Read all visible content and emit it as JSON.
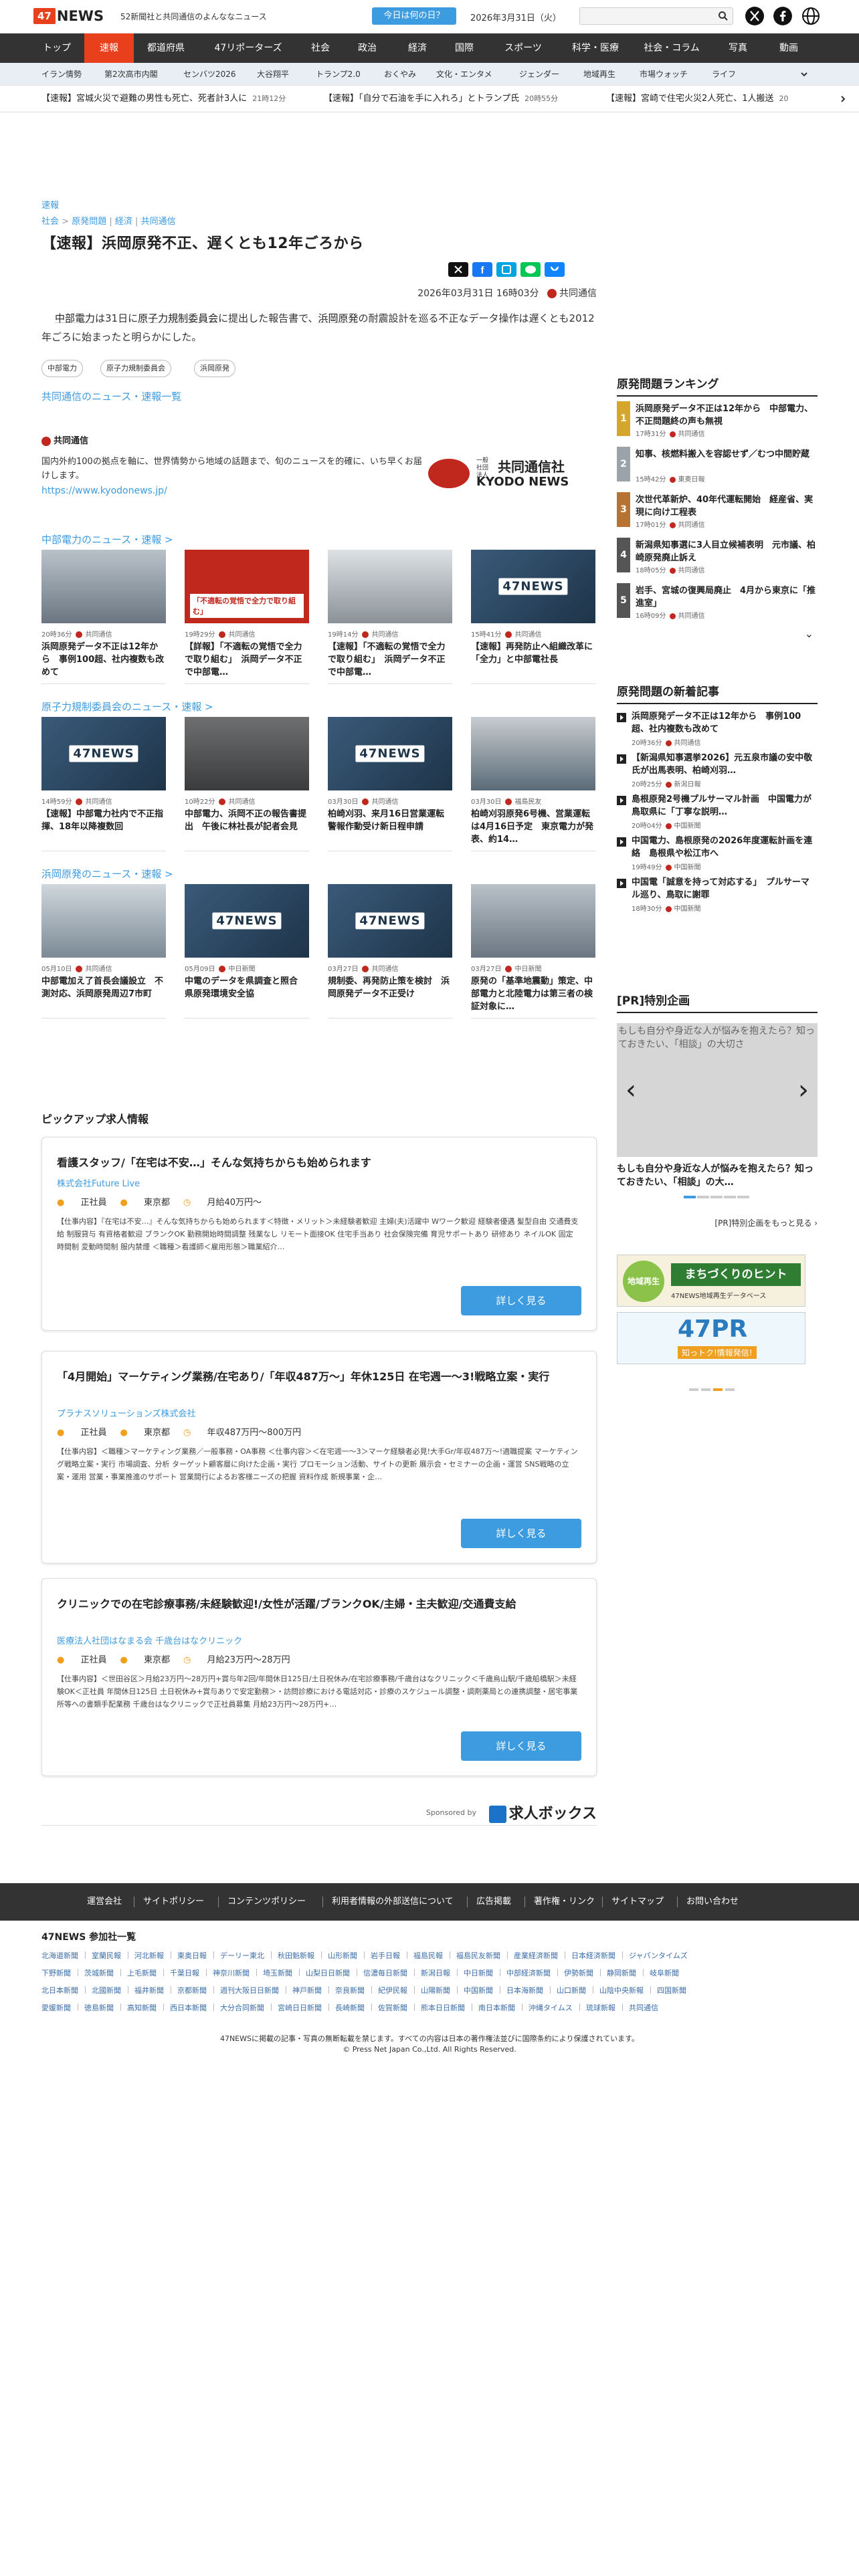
{
  "header": {
    "logo_box": "47",
    "logo_text": "NEWS",
    "tagline": "52新聞社と共同通信のよんななニュース",
    "day_button": "今日は何の日？",
    "date": "2026年3月31日（火）",
    "search_placeholder": ""
  },
  "nav": [
    "トップ",
    "速報",
    "都道府県",
    "47リポーターズ",
    "社会",
    "政治",
    "経済",
    "国際",
    "スポーツ",
    "科学・医療",
    "社会・コラム",
    "写真",
    "動画"
  ],
  "subnav": [
    "イラン情勢",
    "第2次高市内閣",
    "センバツ2026",
    "大谷翔平",
    "トランプ2.0",
    "おくやみ",
    "文化・エンタメ",
    "ジェンダー",
    "地域再生",
    "市場ウォッチ",
    "ライフ"
  ],
  "ticker": [
    {
      "text": "【速報】宮城火災で避難の男性も死亡、死者計3人に",
      "time": "21時12分"
    },
    {
      "text": "【速報】「自分で石油を手に入れろ」とトランプ氏",
      "time": "20時55分"
    },
    {
      "text": "【速報】宮崎で住宅火災2人死亡、1人搬送",
      "time": "20"
    }
  ],
  "article": {
    "crumb_top": "速報",
    "crumbs": [
      "社会",
      "原発問題",
      "経済",
      "共同通信"
    ],
    "crumb_sep1": ">",
    "crumb_sep2": "|",
    "title": "【速報】浜岡原発不正、遅くとも12年ごろから",
    "datetime": "2026年03月31日 16時03分",
    "source": "共同通信",
    "lead_1": "中部電力",
    "lead_2": "は31日に",
    "lead_3": "原子力規制委員会",
    "lead_4": "に提出した報告書で、",
    "lead_5": "浜岡原発",
    "lead_6": "の耐震設計を巡る不正なデータ操作は遅くとも2012年ごろに始まったと明らかにした。",
    "tags": [
      "中部電力",
      "原子力規制委員会",
      "浜岡原発"
    ],
    "more_link": "共同通信のニュース・速報一覧",
    "kyodo_label": "共同通信",
    "kyodo_desc": "国内外約100の拠点を軸に、世界情勢から地域の話題まで、旬のニュースを的確に、いち早くお届けします。",
    "kyodo_url": "https://www.kyodonews.jp/",
    "kyodo_logo_small": "一般社団法人",
    "kyodo_logo_big": "共同通信社",
    "kyodo_logo_en": "KYODO NEWS"
  },
  "sections": [
    {
      "title": "中部電力のニュース・速報",
      "cards": [
        {
          "time": "20時36分",
          "src": "共同通信",
          "title": "浜岡原発データ不正は12年から　事例100超、社内複数も改めて",
          "img": "photo1"
        },
        {
          "time": "19時29分",
          "src": "共同通信",
          "title": "【詳報】「不適転の覚悟で全力で取り組む」　浜岡データ不正で中部電…",
          "img": "photo2",
          "overlay": "「不適転の覚悟で全力で取り組む」"
        },
        {
          "time": "19時14分",
          "src": "共同通信",
          "title": "【速報】「不適転の覚悟で全力で取り組む」　浜岡データ不正で中部電…",
          "img": "photo3"
        },
        {
          "time": "15時41分",
          "src": "共同通信",
          "title": "【速報】再発防止へ組織改革に「全力」と中部電社長",
          "img": "news"
        }
      ]
    },
    {
      "title": "原子力規制委員会のニュース・速報",
      "cards": [
        {
          "time": "14時59分",
          "src": "共同通信",
          "title": "【速報】中部電力社内で不正指揮、18年以降複数回",
          "img": "news"
        },
        {
          "time": "10時22分",
          "src": "共同通信",
          "title": "中部電力、浜岡不正の報告書提出　午後に林社長が記者会見",
          "img": "photo4"
        },
        {
          "time": "03月30日",
          "src": "共同通信",
          "title": "柏崎刈羽、来月16日営業運転　警報作動受け新日程申請",
          "img": "news"
        },
        {
          "time": "03月30日",
          "src": "福島民友",
          "title": "柏崎刈羽原発6号機、営業運転は4月16日予定　東京電力が発表、約14…",
          "img": "photo5"
        }
      ]
    },
    {
      "title": "浜岡原発のニュース・速報",
      "cards": [
        {
          "time": "05月10日",
          "src": "共同通信",
          "title": "中部電加え了首長会議設立　不測対応、浜岡原発周辺7市町",
          "img": "photo6"
        },
        {
          "time": "05月09日",
          "src": "中日新聞",
          "title": "中電のデータを県調査と照合　県原発環境安全協",
          "img": "news"
        },
        {
          "time": "03月27日",
          "src": "共同通信",
          "title": "規制委、再発防止策を検討　浜岡原発データ不正受け",
          "img": "news"
        },
        {
          "time": "03月27日",
          "src": "中日新聞",
          "title": "原発の「基準地震動」策定、中部電力と北陸電力は第三者の検証対象に…",
          "img": "photo1"
        }
      ]
    }
  ],
  "pickup": {
    "heading": "ピックアップ求人情報",
    "jobs": [
      {
        "title": "看護スタッフ/「在宅は不安…」そんな気持ちからも始められます",
        "company": "株式会社Future Live",
        "type": "正社員",
        "place": "東京都",
        "salary": "月給40万円〜",
        "desc": "【仕事内容】『在宅は不安…』そんな気持ちからも始められます＜特徴・メリット＞未経験者歓迎 主婦(夫)活躍中 Wワーク歓迎 経験者優遇 髪型自由 交通費支給 制服貸与 有資格者歓迎 ブランクOK 勤務開始時間調整 残業なし リモート面接OK 住宅手当あり 社会保険完備 育児サポートあり 研修あり ネイルOK 固定時間制 変動時間制 服内禁煙 ＜職種＞看護師＜雇用形態＞職業紹介…",
        "button": "詳しく見る"
      },
      {
        "title": "「4月開始」マーケティング業務/在宅あり/「年収487万〜」年休125日 在宅週一〜3!戦略立案・実行",
        "company": "プラナスソリューションズ株式会社",
        "type": "正社員",
        "place": "東京都",
        "salary": "年収487万円〜800万円",
        "desc": "【仕事内容】＜職種＞マーケティング業務／一般事務・OA事務 ＜仕事内容＞＜在宅週一〜3＞マーケ経験者必見!大手Gr/年収487万〜!適職提案 マーケティング戦略立案・実行 市場調査、分析 ターゲット顧客層に向けた企画・実行 プロモーション活動、サイトの更新 展示会・セミナーの企画・運営 SNS戦略の立案・運用 営業・事業推進のサポート 営業間行によるお客様ニーズの把握 資料作成 新規事業・企…",
        "button": "詳しく見る"
      },
      {
        "title": "クリニックでの在宅診療事務/未経験歓迎!/女性が活躍/ブランクOK/主婦・主夫歓迎/交通費支給",
        "company": "医療法人社団はなまる会 千歳台はなクリニック",
        "type": "正社員",
        "place": "東京都",
        "salary": "月給23万円〜28万円",
        "desc": "【仕事内容】＜世田谷区＞月給23万円〜28万円+賞与年2回/年間休日125日/土日祝休み/在宅診療事務/千歳台はなクリニック＜千歳烏山駅/千歳船橋駅＞未経験OK＜正社員 年間休日125日 土日祝休み+賞与ありで安定勤務＞・訪問診療における電話対応・診療のスケジュール調整・調剤薬局との連携調整・居宅事業所等への書類手配業務 千歳台はなクリニックで正社員募集 月給23万円〜28万円+…",
        "button": "詳しく見る"
      }
    ],
    "sponsored": "Sponsored by",
    "sponsor_name": "求人ボックス"
  },
  "sidebar": {
    "ranking_title": "原発問題ランキング",
    "ranking": [
      {
        "n": "1",
        "title": "浜岡原発データ不正は12年から　中部電力、不正問題終の声も無視",
        "meta": "17時31分",
        "src": "共同通信",
        "color": "#d4a72c"
      },
      {
        "n": "2",
        "title": "知事、核燃料搬入を容認せず／むつ中間貯蔵",
        "meta": "15時42分",
        "src": "東奥日報",
        "color": "#9aa3a9"
      },
      {
        "n": "3",
        "title": "次世代革新炉、40年代運転開始　経産省、実現に向け工程表",
        "meta": "17時01分",
        "src": "共同通信",
        "color": "#b87333"
      },
      {
        "n": "4",
        "title": "新潟県知事選に3人目立候補表明　元市議、柏崎原発廃止訴え",
        "meta": "18時05分",
        "src": "共同通信",
        "color": "#555"
      },
      {
        "n": "5",
        "title": "岩手、宮城の復興局廃止　4月から東京に「推進室」",
        "meta": "16時09分",
        "src": "共同通信",
        "color": "#555"
      }
    ],
    "new_title": "原発問題の新着記事",
    "new_items": [
      {
        "title": "浜岡原発データ不正は12年から　事例100超、社内複数も改めて",
        "meta": "20時36分",
        "src": "共同通信"
      },
      {
        "title": "【新潟県知事選挙2026】元五泉市議の安中敬氏が出馬表明、柏崎刈羽…",
        "meta": "20時25分",
        "src": "新潟日報"
      },
      {
        "title": "島根原発2号機プルサーマル計画　中国電力が鳥取県に「丁寧な説明…",
        "meta": "20時04分",
        "src": "中国新聞"
      },
      {
        "title": "中国電力、島根原発の2026年度運転計画を連絡　島根県や松江市へ",
        "meta": "19時49分",
        "src": "中国新聞"
      },
      {
        "title": "中国電「誠意を持って対応する」　プルサーマル巡り、鳥取に謝罪",
        "meta": "18時30分",
        "src": "中国新聞"
      }
    ],
    "pr_title": "[PR]特別企画",
    "pr_alt": "もしも自分や身近な人が悩みを抱えたら？知っておきたい、「相談」の大切さ",
    "pr_caption": "もしも自分や身近な人が悩みを抱えたら？知っておきたい、「相談」の大…",
    "pr_more": "[PR]特別企画をもっと見る",
    "banner1": "まちづくりのヒント",
    "banner1_sub": "地域再生",
    "banner1_small": "47NEWS地域再生データベース",
    "banner2": "47PR",
    "banner2_sub": "知っトク!情報発信!"
  },
  "footer": {
    "links": [
      "運営会社",
      "サイトポリシー",
      "コンテンツポリシー",
      "利用者情報の外部送信について",
      "広告掲載",
      "著作権・リンク",
      "サイトマップ",
      "お問い合わせ"
    ],
    "members_title": "47NEWS 参加社一覧",
    "members": [
      [
        "北海道新聞",
        "室蘭民報",
        "河北新報",
        "東奥日報",
        "デーリー東北",
        "秋田魁新報",
        "山形新聞",
        "岩手日報",
        "福島民報",
        "福島民友新聞",
        "産業経済新聞",
        "日本経済新聞",
        "ジャパンタイムズ"
      ],
      [
        "下野新聞",
        "茨城新聞",
        "上毛新聞",
        "千葉日報",
        "神奈川新聞",
        "埼玉新聞",
        "山梨日日新聞",
        "信濃毎日新聞",
        "新潟日報",
        "中日新聞",
        "中部経済新聞",
        "伊勢新聞",
        "静岡新聞",
        "岐阜新聞"
      ],
      [
        "北日本新聞",
        "北國新聞",
        "福井新聞",
        "京都新聞",
        "週刊大阪日日新聞",
        "神戸新聞",
        "奈良新聞",
        "紀伊民報",
        "山陽新聞",
        "中国新聞",
        "日本海新聞",
        "山口新聞",
        "山陰中央新報",
        "四国新聞"
      ],
      [
        "愛媛新聞",
        "徳島新聞",
        "高知新聞",
        "西日本新聞",
        "大分合同新聞",
        "宮崎日日新聞",
        "長崎新聞",
        "佐賀新聞",
        "熊本日日新聞",
        "南日本新聞",
        "沖縄タイムス",
        "琉球新報",
        "共同通信"
      ]
    ],
    "copy1": "47NEWSに掲載の記事・写真の無断転載を禁じます。すべての内容は日本の著作権法並びに国際条約により保護されています。",
    "copy2": "© Press Net Japan Co.,Ltd. All Rights Reserved."
  },
  "colors": {
    "accent": "#e8401c",
    "link": "#3d9be0",
    "nav_bg": "#333333",
    "button": "#3d9be0"
  }
}
